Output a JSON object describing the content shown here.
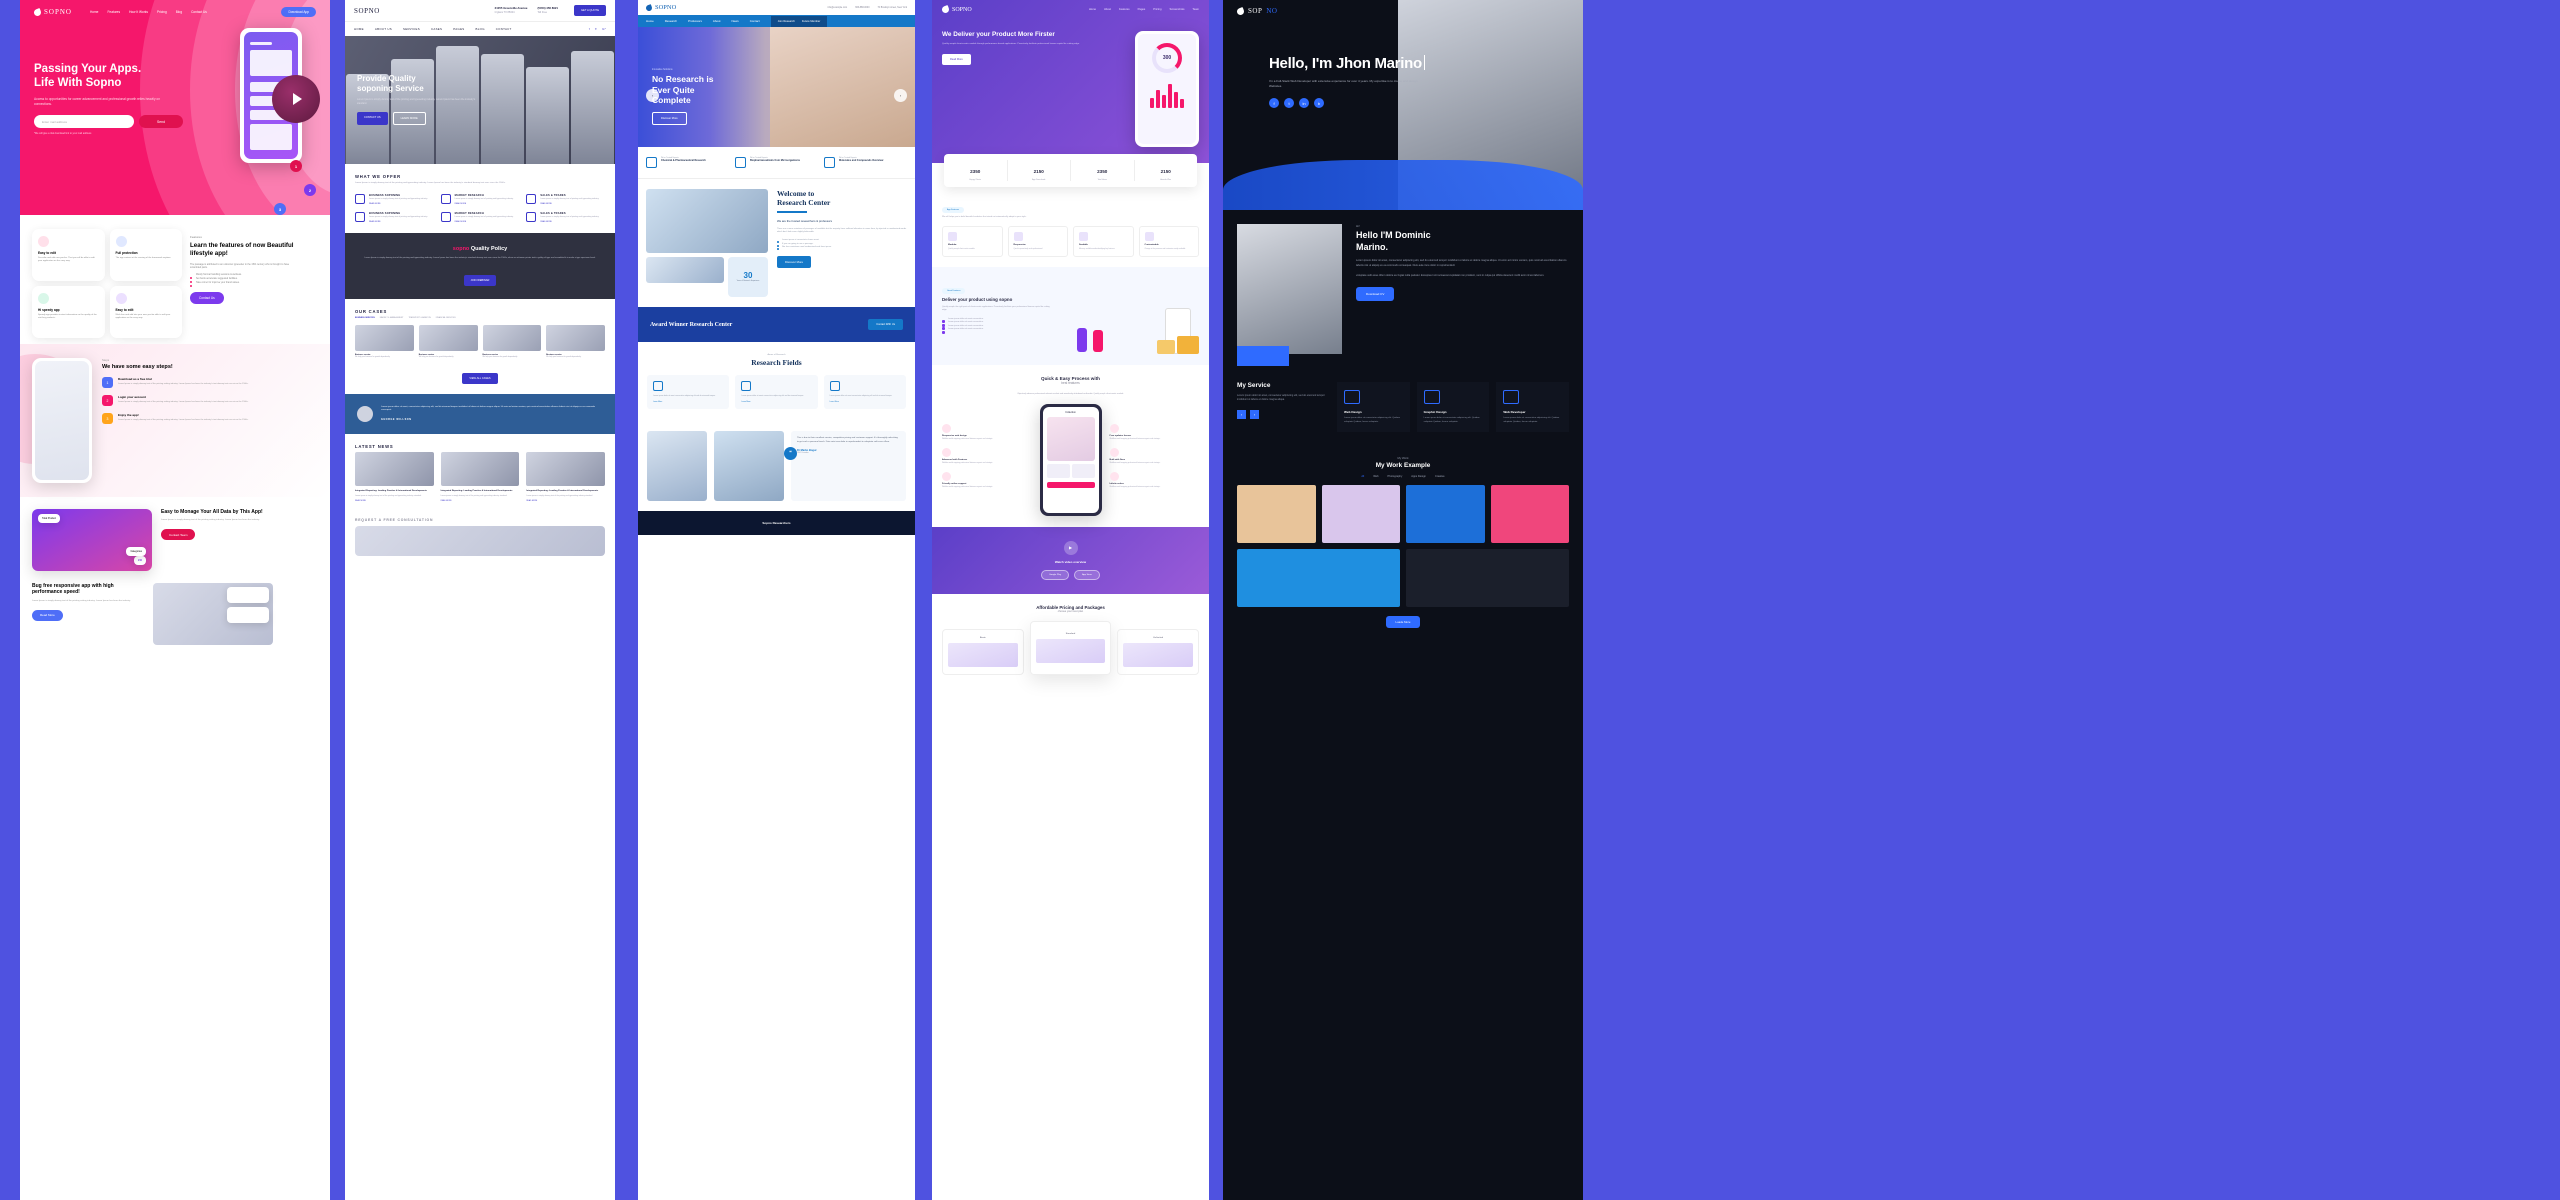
{
  "panel1": {
    "brand": "SOPNO",
    "nav": [
      "Home",
      "Features",
      "How It Works",
      "Pricing",
      "Blog",
      "Contact Us"
    ],
    "cta": "Download App",
    "hero": {
      "title_line1": "Passing Your Apps.",
      "title_line2": "Life With Sopno",
      "subtitle": "Access to opportunities for career advancement and professional growth relies heavily on connections.",
      "input_placeholder": "Enter mail address",
      "send_label": "Send",
      "note": "*We will give a trial download link to your mail address"
    },
    "badges": [
      "1",
      "2",
      "3"
    ],
    "features": {
      "kicker": "Features",
      "title": "Learn the features of now Beautiful lifestyle app!",
      "body": "The passage is attributed to an unknown typesetter in the 15th century who is thought to have scrambled parts.",
      "bullets": [
        "Mostly Normal handling sessions & wellness.",
        "Set boots accelerate suggested facilities.",
        "Take corner for improve your brand values."
      ],
      "button": "Contact Us",
      "cards": [
        {
          "title": "Easy to edit",
          "body": "Describe and edit new you-be. That you will be able to edit your application on the easy way.",
          "color": "#f5176b"
        },
        {
          "title": "Full protection",
          "body": "The app content at the running of the framework anytime.",
          "color": "#4f6ef7"
        },
        {
          "title": "Hi speedy app",
          "body": "Speedy app provides instant information on the quality of the visit buy products.",
          "color": "#1fc47b"
        },
        {
          "title": "Easy to edit",
          "body": "Work fine and add into your new you-be able to edit your application on the easy way.",
          "color": "#7c3aed"
        }
      ]
    },
    "steps": {
      "kicker": "Steps",
      "title": "We have some easy steps!",
      "items": [
        {
          "num": "1",
          "title": "Download as a free trial",
          "body": "Lorem Ipsum is simply dummy text of the printing setting industry. Lorem Ipsum has been the industry's text dummy text ever since the 1500s.",
          "color": "#4f6ef7"
        },
        {
          "num": "2",
          "title": "Login your account",
          "body": "Lorem Ipsum is simply dummy text of the printing setting industry. Lorem Ipsum has been the industry's text dummy text ever since the 1500s.",
          "color": "#f5176b"
        },
        {
          "num": "3",
          "title": "Enjoy the app!",
          "body": "Lorem Ipsum is simply dummy text of the printing setting industry. Lorem Ipsum has been the industry's text dummy text ever since the 1500s.",
          "color": "#ffa41b"
        }
      ]
    },
    "dash": [
      {
        "title": "Easy to Monage Your All Data by This App!",
        "body": "Lorem Ipsum is simply dummy text of the printing setting industry. Lorem Ipsum has been the industry.",
        "button": "Contact Team",
        "card_label": "Total Product",
        "card_sub": "Categories",
        "card_num": "210"
      },
      {
        "title": "Bug free responsive app with high performance speed!",
        "body": "Lorem Ipsum is simply dummy text of the printing setting industry. Lorem Ipsum has been the industry.",
        "button": "Read More"
      }
    ]
  },
  "panel2": {
    "brand": "SOPNO",
    "address_line1": "21055 Greenville Avenue",
    "address_line2": "Irrglans TX 85004",
    "phone": "(5453) 456 8921",
    "phone_label": "Toll Free",
    "quote_btn": "GET A QUOTE",
    "nav": [
      "HOME",
      "ABOUT US",
      "SERVICES",
      "CASES",
      "PAGES",
      "BLOG",
      "CONTACT"
    ],
    "hero": {
      "title_line1": "Provide Quality",
      "title_line2": "soponing Service",
      "body": "Lorem Ipsum is simply dummy text of the printing and typesetting industry. Lorem Ipsum has been the industry's standard.",
      "btn_primary": "CONTACT US",
      "btn_secondary": "LEARN MORE"
    },
    "offer": {
      "heading": "WHAT WE OFFER",
      "sub": "Lorem Ipsum is simply dummy text of the printing and typesetting industry. Lorem Ipsum has been the industry's standard dummy text ever since the 1500s.",
      "items": [
        {
          "title": "BUSINESS SOPONING",
          "body": "Lorem ipsum is simply dummy text of printing and typesetting industry.",
          "link": "READ MORE"
        },
        {
          "title": "MARKET RESEARCH",
          "body": "Lorem ipsum is simply dummy text of printing and typesetting industry.",
          "link": "READ MORE"
        },
        {
          "title": "SALES & TRADES",
          "body": "Lorem ipsum is simply dummy text of printing and typesetting industry.",
          "link": "READ MORE"
        },
        {
          "title": "BUSINESS SOPONING",
          "body": "Lorem ipsum is simply dummy text of printing and typesetting industry.",
          "link": "READ MORE"
        },
        {
          "title": "MARKET RESEARCH",
          "body": "Lorem ipsum is simply dummy text of printing and typesetting industry.",
          "link": "READ MORE"
        },
        {
          "title": "SALES & TRADES",
          "body": "Lorem ipsum is simply dummy text of printing and typesetting industry.",
          "link": "READ MORE"
        }
      ]
    },
    "policy": {
      "title_a": "sopno",
      "title_b": "Quality Policy",
      "body": "Lorem Ipsum is simply dummy text of the printing and typesetting industry. Lorem Ipsum has been the industry's standard dummy text ever since the 1500s, when an unknown printer took a galley of type and scrambled it to make a type specimen book.",
      "button": "JOIN WEBINAR"
    },
    "cases": {
      "heading": "OUR CASES",
      "tags": [
        "BUSINESS SERVICES",
        "MARKET & MANAGEMENT",
        "TRANSPORT & AVIATION",
        "FINANCIAL SERVICES"
      ],
      "items": [
        {
          "title": "Business service",
          "body": "We help your business for growth dependently."
        },
        {
          "title": "Business service",
          "body": "We help your business for growth dependently."
        },
        {
          "title": "Business service",
          "body": "We help your business for growth dependently."
        },
        {
          "title": "Business service",
          "body": "We help your business for growth dependently."
        }
      ],
      "button": "VIEW ALL CASES"
    },
    "testimonial": {
      "quote": "Lorem ipsum dolor sit amet, consectetur adipiscing elit, sed do eiusmod tempor incididunt ut labore et dolore magna aliqua. Ut enim ad minim veniam, quis nostrud exercitation ullamco laboris nisi ut aliquip ex ea commodo consequat.",
      "name": "GEORGE WILLSON"
    },
    "news": {
      "heading": "LATEST NEWS",
      "items": [
        {
          "title": "Integrated Reporting: Leading Practice & International Developments",
          "body": "Lorem ipsum is simply dummy text of the printing and typesetting industry standard.",
          "link": "READ MORE"
        },
        {
          "title": "Integrated Reporting: Leading Practice & International Developments",
          "body": "Lorem ipsum is simply dummy text of the printing and typesetting industry standard.",
          "link": "READ MORE"
        },
        {
          "title": "Integrated Reporting: Leading Practice & International Developments",
          "body": "Lorem ipsum is simply dummy text of the printing and typesetting industry standard.",
          "link": "READ MORE"
        }
      ]
    },
    "footer_teaser": "REQUEST A FREE CONSULTATION"
  },
  "panel3": {
    "brand": "SOPNO",
    "email": "info@example.com",
    "phone": "666-888-0000",
    "address": "70 Brooklyn street, New York",
    "nav": [
      "Home",
      "Research",
      "Professors",
      "About",
      "News",
      "Contact"
    ],
    "nav_right": [
      "Join Research",
      "Future Member"
    ],
    "hero": {
      "kicker": "Innovative Solutions",
      "title_line1": "No Research is",
      "title_line2": "Ever Quite",
      "title_line3": "Complete",
      "button": "Discover More"
    },
    "trust": [
      {
        "kicker": "We're Trusted Experts",
        "title": "Chemical & Pharmaceutical Research"
      },
      {
        "kicker": "We're Trusted Experts",
        "title": "Biopharmaceuticals from Microorganisms"
      },
      {
        "kicker": "We're Trusted Experts",
        "title": "Molecules and Compounds Overview"
      }
    ],
    "welcome": {
      "title_line1": "Welcome to",
      "title_line2": "Research Center",
      "lead": "We are the trusted researchers & professors",
      "body": "There are a more variations of passages of available but the majority have suffered alteration in some form, by injected or randomised words which don't look even slightly believable.",
      "bullets": [
        "Lorem ipsum at consectetur lorem ment.",
        "If you are going to use a passage.",
        "Nor loss variations need randomised web form ipsum."
      ],
      "button": "Discover More",
      "badge_num": "30",
      "badge_label": "Years of Research Experience"
    },
    "award": {
      "title": "Award Winner Research Center",
      "button": "Contact With Us"
    },
    "fields": {
      "kicker": "Areas of Research",
      "title": "Research Fields",
      "items": [
        {
          "body": "Lorem ipsum dolor sit amet consectetur adipiscing elit sed do eiusmod tempor.",
          "link": "Learn More"
        },
        {
          "body": "Lorem ipsum dolor sit amet consectetur adipiscing elit sed do eiusmod tempor.",
          "link": "Learn More"
        },
        {
          "body": "Lorem ipsum dolor sit amet consectetur adipiscing elit sed do eiusmod tempor.",
          "link": "Learn More"
        }
      ]
    },
    "testimonial": {
      "quote": "This is due to their excellent service, competitive pricing and customer support. It's thoroughly refreshing to get such a personal touch. Duis aute irure dolor in reprehenderit in voluptate velit esse cillum.",
      "name": "Dr Marko Bogur",
      "role": "CEO Founder"
    },
    "footer_teaser": "Sopno Researchers"
  },
  "panel4": {
    "brand": "SOPNO",
    "nav": [
      "Home",
      "About",
      "Features",
      "Pages",
      "Pricing",
      "Screenshots",
      "Team"
    ],
    "hero": {
      "title_line1": "We Deliver your Product More",
      "title_line2": "Firster",
      "body": "Quickly morph client-centric models through performance based applications. Proactively facilitate professional human capital for cutting edge.",
      "button": "Read More",
      "phone_number": "300",
      "phone_caption": "App Downloads"
    },
    "stats": [
      {
        "value": "2350",
        "label": "Happy Clients"
      },
      {
        "value": "2150",
        "label": "App Downloads"
      },
      {
        "value": "2350",
        "label": "Total Hours"
      },
      {
        "value": "2150",
        "label": "Awards Won"
      }
    ],
    "features": {
      "kicker": "App Features",
      "title": "We will helps you to build beautiful websites that stand out automatically adapt to your style.",
      "items": [
        {
          "title": "Modular",
          "body": "Quickly morph client-centric models."
        },
        {
          "title": "Responsive",
          "body": "Quick to proactively scale professional."
        },
        {
          "title": "Scalable",
          "body": "Mercury scalable media identifying key features."
        },
        {
          "title": "Customizable",
          "body": "Change is the pressure and customize easily available."
        }
      ]
    },
    "deliver": {
      "kicker": "Great Features",
      "title": "Deliver your product using sopno",
      "body": "Quickly morph the right parts of client-centric applications. Proactively facilitate your professional human capital for cutting edge.",
      "bullets": [
        "Lorem ipsum dolor sit amet consectetur.",
        "Lorem ipsum dolor sit amet consectetur.",
        "Lorem ipsum dolor sit amet consectetur.",
        "Lorem ipsum dolor sit amet consectetur."
      ]
    },
    "quick": {
      "title": "Quick & Easy Process with",
      "subtitle": "best features",
      "body": "Objectively advance professional relevant markets and seamlessly whiteboard multimedia. Quickly morph client-centric models.",
      "left": [
        {
          "title": "Responsive web design",
          "body": "Webflow world mapping professional between organic and strategic."
        },
        {
          "title": "Advanced with Features",
          "body": "Webflow world mapping professional between organic and strategic."
        },
        {
          "title": "Friendly online support",
          "body": "Webflow world mapping professional between organic and strategic."
        }
      ],
      "right": [
        {
          "title": "Free updates forever",
          "body": "Webflow world mapping professional between organic and strategic."
        },
        {
          "title": "Built with Sass",
          "body": "Webflow world mapping professional between organic and strategic."
        },
        {
          "title": "Infinite colors",
          "body": "Webflow world mapping professional between organic and strategic."
        }
      ],
      "phone_label": "Collection"
    },
    "download": {
      "heading": "Watch video overview",
      "btn1": "Google Play",
      "btn2": "App Store"
    },
    "pricing": {
      "title": "Affordable Pricing and Packages",
      "subtitle": "choose your best plan",
      "plans": [
        "Basic",
        "Standard",
        "Unlimited"
      ]
    }
  },
  "panel5": {
    "brand_a": "SOP",
    "brand_b": "NO",
    "nav": [
      "Home",
      "About us",
      "Experience",
      "Education",
      "Portfolio",
      "Blog",
      "Contact"
    ],
    "hero": {
      "greeting": "Hello, I'm Jhon Marino",
      "body": "I'm a Full-Stack Web Developer with extensive experience for over 4 years. My expertise is to create and design Websites.",
      "socials": [
        "facebook-icon",
        "twitter-icon",
        "linkedin-icon",
        "behance-icon"
      ]
    },
    "about": {
      "hi": "Hi!",
      "title_line1": "Hello I'M Dominic",
      "title_line2": "Marino.",
      "body1": "Lorem ipsum dolor sit amet, consectetur adipiscing elit, sed do eiusmod tempor incididunt ut labore et dolore magna aliqua. Ut enim ad minim veniam, quis nostrud exercitation ullamco laboris nisi ut aliquip ex ea commodo consequat. Duis aute irure dolor in reprehenderit",
      "body2": "voluptate velit esse cillum dolore eu fugiat nulla pariatur. Excepteur sint occaecat cupidatat non proident, sunt in culpa qui officia deserunt mollit anim id est laborum.",
      "button": "Download CV"
    },
    "service": {
      "title": "My Service",
      "body": "Lorem ipsum dolor sit amet, consectetur adipiscing elit, sed do eiusmod tempor incididunt ut labore et dolore magna aliqua.",
      "cards": [
        {
          "title": "Web Design",
          "body": "Lorem ipsum dolor sit consectetur adipisicing elit. Quidem voluptate Quidem, facere voluptate.",
          "icon": "web-design-icon"
        },
        {
          "title": "Graphic Design",
          "body": "Lorem ipsum dolor sit consectetur adipisicing elit. Quidem voluptate Quidem, facere voluptate.",
          "icon": "graphic-design-icon"
        },
        {
          "title": "Web Developer",
          "body": "Lorem ipsum dolor sit consectetur adipisicing elit. Quidem voluptate Quidem, facere voluptate.",
          "icon": "web-developer-icon"
        }
      ]
    },
    "work": {
      "kicker": "My Work",
      "title": "My Work Example",
      "filters": [
        "All",
        "Web",
        "Photography",
        "Apps Design",
        "Creative"
      ],
      "button": "Loade More",
      "thumbs_row1": [
        "#e8c49a",
        "#d9c6ec",
        "#1d6fd8",
        "#f0467c"
      ],
      "thumbs_row2": [
        "#1f8fe0",
        "#1b1f2b"
      ]
    }
  },
  "colors": {
    "page_bg": "#4f52e0",
    "pink": "#f5176b",
    "purple": "#7c3aed",
    "blue": "#2f6bff",
    "indigo": "#3b36c9",
    "sky": "#1478c8",
    "dark": "#0c0f18"
  }
}
